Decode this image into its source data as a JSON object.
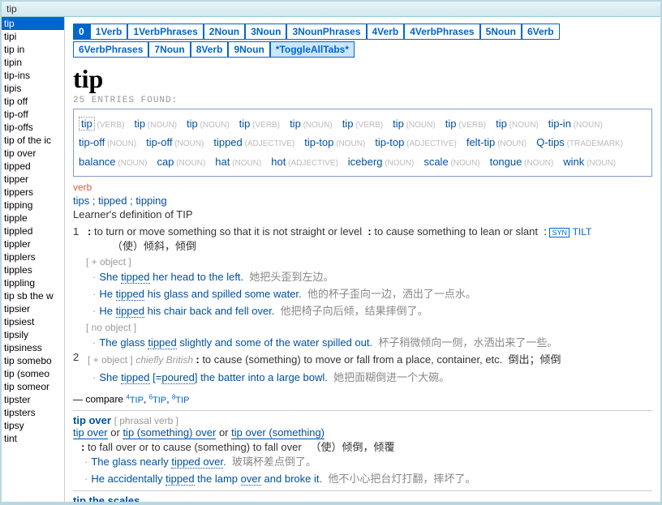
{
  "title": "tip",
  "sidebar": {
    "items": [
      "tip",
      "tipi",
      "tip in",
      "tipin",
      "tip-ins",
      "tipis",
      "tip off",
      "tip-off",
      "tip-offs",
      "tip of the ic",
      "tip over",
      "tipped",
      "tipper",
      "tippers",
      "tipping",
      "tipple",
      "tippled",
      "tippler",
      "tipplers",
      "tipples",
      "tippling",
      "tip sb the w",
      "tipsier",
      "tipsiest",
      "tipsily",
      "tipsiness",
      "tip somebo",
      "tip (someo",
      "tip someor",
      "tipster",
      "tipsters",
      "tipsy",
      "tint"
    ],
    "selected": 0
  },
  "tabs": {
    "row1": [
      "0",
      "1Verb",
      "1VerbPhrases",
      "2Noun",
      "3Noun",
      "3NounPhrases",
      "4Verb",
      "4VerbPhrases",
      "5Noun",
      "6Verb"
    ],
    "row2": [
      "6VerbPhrases",
      "7Noun",
      "8Verb",
      "9Noun",
      "*ToggleAllTabs*"
    ],
    "active": "0"
  },
  "headword": "tip",
  "entries_found": "25 ENTRIES FOUND:",
  "cloud": [
    {
      "w": "tip",
      "p": "(VERB)",
      "boxed": true
    },
    {
      "w": "tip",
      "p": "(NOUN)"
    },
    {
      "w": "tip",
      "p": "(NOUN)"
    },
    {
      "w": "tip",
      "p": "(VERB)"
    },
    {
      "w": "tip",
      "p": "(NOUN)"
    },
    {
      "w": "tip",
      "p": "(VERB)"
    },
    {
      "w": "tip",
      "p": "(NOUN)"
    },
    {
      "w": "tip",
      "p": "(VERB)"
    },
    {
      "w": "tip",
      "p": "(NOUN)"
    },
    {
      "w": "tip-in",
      "p": "(NOUN)"
    },
    {
      "w": "tip-off",
      "p": "(NOUN)"
    },
    {
      "w": "tip-off",
      "p": "(NOUN)"
    },
    {
      "w": "tipped",
      "p": "(ADJECTIVE)"
    },
    {
      "w": "tip-top",
      "p": "(NOUN)"
    },
    {
      "w": "tip-top",
      "p": "(ADJECTIVE)"
    },
    {
      "w": "felt-tip",
      "p": "(NOUN)"
    },
    {
      "w": "Q-tips",
      "p": "(TRADEMARK)"
    },
    {
      "w": "balance",
      "p": "(NOUN)"
    },
    {
      "w": "cap",
      "p": "(NOUN)"
    },
    {
      "w": "hat",
      "p": "(NOUN)"
    },
    {
      "w": "hot",
      "p": "(ADJECTIVE)"
    },
    {
      "w": "iceberg",
      "p": "(NOUN)"
    },
    {
      "w": "scale",
      "p": "(NOUN)"
    },
    {
      "w": "tongue",
      "p": "(NOUN)"
    },
    {
      "w": "wink",
      "p": "(NOUN)"
    }
  ],
  "pos": "verb",
  "forms": "tips ; tipped ; tipping",
  "def_header": "Learner's definition of TIP",
  "sense1": {
    "num": "1",
    "def_a": "to turn or move something so that it is not straight or level",
    "def_b": "to cause something to lean or slant",
    "syn_badge": "SYN",
    "syn": "TILT",
    "zh": "（使）倾斜，倾倒",
    "gram_obj": "[ + object ]",
    "ex1_pre": "She ",
    "ex1_w": "tipped",
    "ex1_post": " her head to the left.",
    "ex1_zh": "她把头歪到左边。",
    "ex2_pre": "He ",
    "ex2_w": "tipped",
    "ex2_post": " his glass and spilled some water.",
    "ex2_zh": "他的杯子歪向一边，洒出了一点水。",
    "ex3_pre": "He ",
    "ex3_w": "tipped",
    "ex3_post": " his chair back and fell over.",
    "ex3_zh": "他把椅子向后倾，结果摔倒了。",
    "gram_noobj": "[ no object ]",
    "ex4_pre": "The glass ",
    "ex4_w": "tipped",
    "ex4_post": " slightly and some of the water spilled out.",
    "ex4_zh": "杯子稍微倾向一侧，水洒出来了一些。"
  },
  "sense2": {
    "num": "2",
    "gram": "[ + object ]",
    "label": "chiefly British",
    "def": "to cause (something) to move or fall from a place, container, etc.",
    "zh": "倒出；倾倒",
    "ex1_pre": "She ",
    "ex1_w": "tipped",
    "ex1_eq": " [=",
    "ex1_eqw": "poured",
    "ex1_eqend": "]",
    "ex1_post": " the batter into a large bowl.",
    "ex1_zh": "她把面糊倒进一个大碗。"
  },
  "compare": {
    "pre": "— compare ",
    "l1": "TIP",
    "l2": "TIP",
    "l3": "TIP",
    "s1": "4",
    "s2": "6",
    "s3": "8"
  },
  "phrasal": {
    "head": "tip over",
    "gram": "[ phrasal verb ]",
    "forms_a": "tip over",
    "forms_or1": " or ",
    "forms_b": "tip (something) over",
    "forms_or2": " or ",
    "forms_c": "tip over (something)",
    "def": "to fall over or to cause (something) to fall over",
    "zh": "（使）倾倒，倾覆",
    "ex1_pre": "The glass nearly ",
    "ex1_w": "tipped over",
    "ex1_post": ".",
    "ex1_zh": "玻璃杯差点倒了。",
    "ex2_pre": "He accidentally ",
    "ex2_w": "tipped",
    "ex2_mid": " the lamp ",
    "ex2_w2": "over",
    "ex2_post": " and broke it.",
    "ex2_zh": "他不小心把台灯打翻，摔坏了。"
  },
  "phrasal2": {
    "head": "tip the scales"
  }
}
